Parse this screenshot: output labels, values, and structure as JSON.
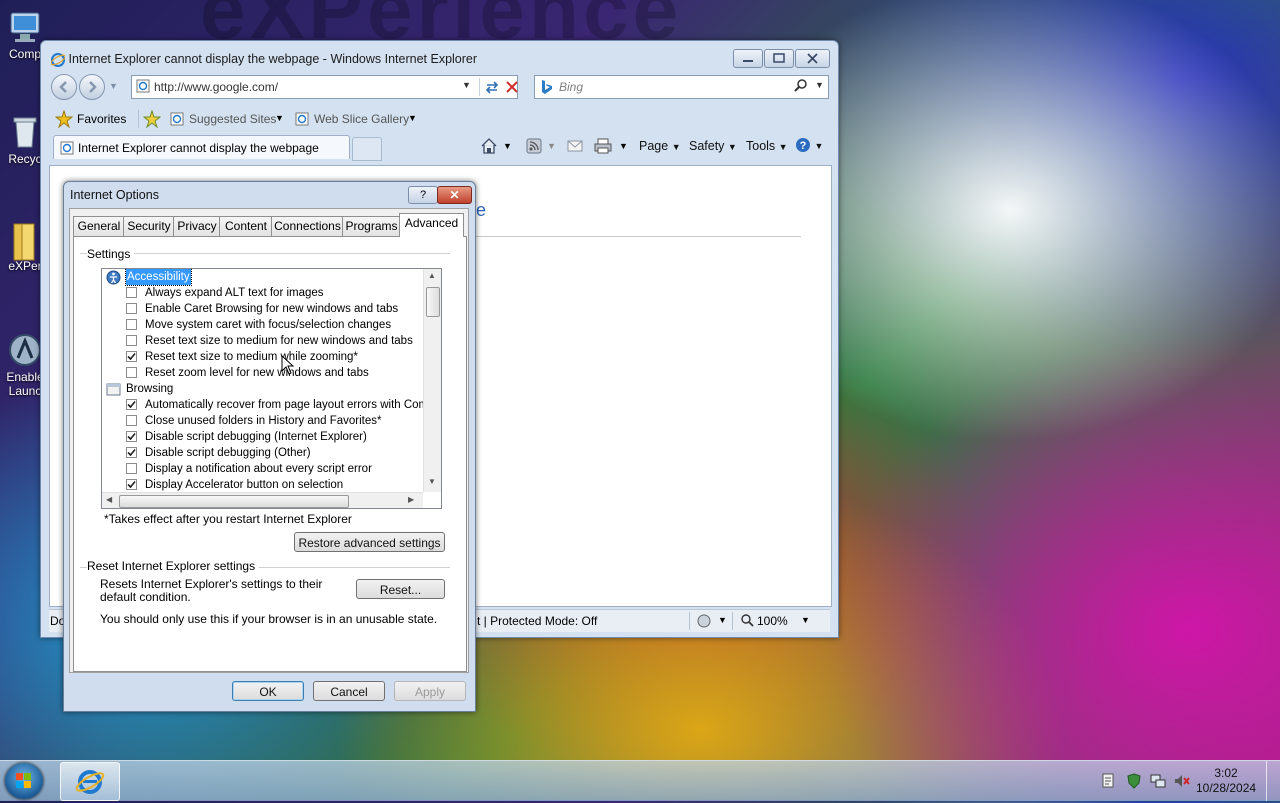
{
  "desktop": {
    "watermark": "eXPerience",
    "icons": [
      "Comp",
      "Recyc",
      "eXPer",
      "Enable",
      "Launc"
    ]
  },
  "ie": {
    "window_title": "Internet Explorer cannot display the webpage - Windows Internet Explorer",
    "address": "http://www.google.com/",
    "search_placeholder": "Bing",
    "favorites": "Favorites",
    "suggested_sites": "Suggested Sites",
    "web_slice_gallery": "Web Slice Gallery",
    "tab_title": "Internet Explorer cannot display the webpage",
    "commands": {
      "page": "Page",
      "safety": "Safety",
      "tools": "Tools"
    },
    "content_fragment": "e",
    "status": {
      "left": "Do",
      "protected_mode": "t | Protected Mode: Off",
      "zoom": "100%"
    }
  },
  "dialog": {
    "title": "Internet Options",
    "tabs": [
      "General",
      "Security",
      "Privacy",
      "Content",
      "Connections",
      "Programs",
      "Advanced"
    ],
    "active_tab": "Advanced",
    "settings_label": "Settings",
    "tree": [
      {
        "type": "category",
        "label": "Accessibility",
        "selected": true
      },
      {
        "type": "option",
        "label": "Always expand ALT text for images",
        "checked": false
      },
      {
        "type": "option",
        "label": "Enable Caret Browsing for new windows and tabs",
        "checked": false
      },
      {
        "type": "option",
        "label": "Move system caret with focus/selection changes",
        "checked": false
      },
      {
        "type": "option",
        "label": "Reset text size to medium for new windows and tabs",
        "checked": false
      },
      {
        "type": "option",
        "label": "Reset text size to medium while zooming*",
        "checked": true
      },
      {
        "type": "option",
        "label": "Reset zoom level for new windows and tabs",
        "checked": false
      },
      {
        "type": "category",
        "label": "Browsing",
        "selected": false
      },
      {
        "type": "option",
        "label": "Automatically recover from page layout errors with Compa",
        "checked": true
      },
      {
        "type": "option",
        "label": "Close unused folders in History and Favorites*",
        "checked": false
      },
      {
        "type": "option",
        "label": "Disable script debugging (Internet Explorer)",
        "checked": true
      },
      {
        "type": "option",
        "label": "Disable script debugging (Other)",
        "checked": true
      },
      {
        "type": "option",
        "label": "Display a notification about every script error",
        "checked": false
      },
      {
        "type": "option",
        "label": "Display Accelerator button on selection",
        "checked": true
      }
    ],
    "restart_note": "*Takes effect after you restart Internet Explorer",
    "restore_button": "Restore advanced settings",
    "reset_group_label": "Reset Internet Explorer settings",
    "reset_description": "Resets Internet Explorer's settings to their default condition.",
    "reset_button": "Reset...",
    "reset_warning": "You should only use this if your browser is in an unusable state.",
    "ok": "OK",
    "cancel": "Cancel",
    "apply": "Apply"
  },
  "taskbar": {
    "time": "3:02",
    "date": "10/28/2024"
  }
}
